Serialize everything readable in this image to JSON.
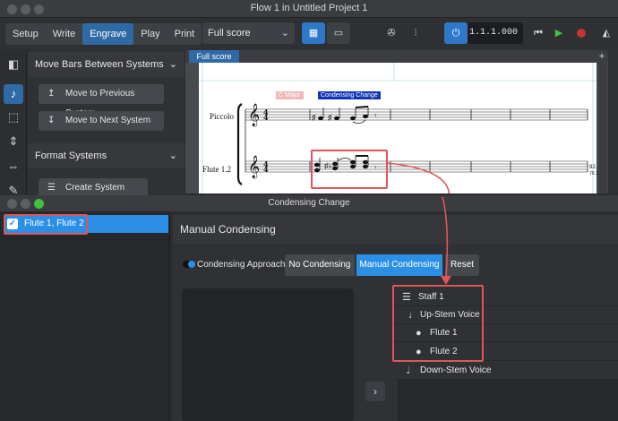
{
  "window": {
    "title": "Flow 1 in Untitled Project 1"
  },
  "toolbar": {
    "modes": [
      "Setup",
      "Write",
      "Engrave",
      "Play",
      "Print"
    ],
    "active_mode": "Engrave",
    "layout_select": "Full score",
    "counter": "1.1.1.000"
  },
  "panel": {
    "move_bars_title": "Move Bars Between Systems",
    "prev_system": "Move to Previous System",
    "next_system": "Move to Next System",
    "format_title": "Format Systems",
    "create_break": "Create System Break"
  },
  "score": {
    "tab": "Full score",
    "sig_key": "C Major",
    "sig_condensing": "Condensing Change",
    "instr_piccolo": "Piccolo",
    "instr_flute": "Flute 1.2",
    "measure_num": "92.",
    "measure_sub": "70.1"
  },
  "dialog": {
    "title": "Condensing Change",
    "group_label": "Flute 1, Flute 2",
    "heading": "Manual Condensing",
    "approach_label": "Condensing Approach",
    "btn_no": "No Condensing",
    "btn_manual": "Manual Condensing",
    "btn_reset": "Reset",
    "tree": {
      "staff": "Staff 1",
      "up_voice": "Up-Stem Voice",
      "player1": "Flute 1",
      "player2": "Flute 2",
      "down_voice": "Down-Stem Voice"
    }
  },
  "colors": {
    "accent": "#2b8fe6",
    "highlight": "#e05555",
    "mode_active": "#2f6aa6"
  }
}
